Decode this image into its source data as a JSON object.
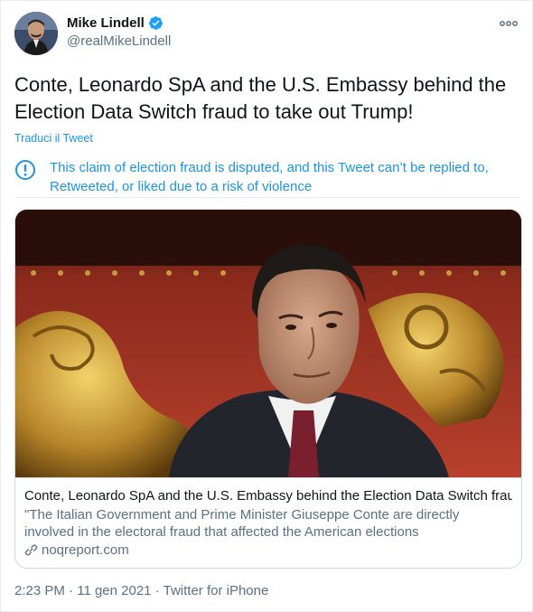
{
  "author": {
    "display_name": "Mike Lindell",
    "handle": "@realMikeLindell"
  },
  "tweet": {
    "text": "Conte, Leonardo SpA and the U.S. Embassy behind the Election Data Switch fraud to take out Trump!",
    "translate_label": "Traduci il Tweet"
  },
  "notice": {
    "text": "This claim of election fraud is disputed, and this Tweet can’t be replied to, Retweeted, or liked due to a risk of violence"
  },
  "card": {
    "title": "Conte, Leonardo SpA and the U.S. Embassy behind the Election Data Switch frau...",
    "description": "\"The Italian Government and Prime Minister Giuseppe Conte are directly involved in the electoral fraud that affected the American elections",
    "domain": "noqreport.com"
  },
  "meta": {
    "time": "2:23 PM",
    "date": "11 gen 2021",
    "source": "Twitter for iPhone",
    "separator": "·"
  },
  "colors": {
    "link_blue": "#1b95e0",
    "verified_blue": "#1da1f2",
    "secondary_text": "#5b7083",
    "border": "#e6ecf0"
  },
  "icons": {
    "verified": "verified-badge-icon",
    "more": "more-options-icon",
    "notice": "info-exclamation-icon",
    "link": "link-icon"
  }
}
